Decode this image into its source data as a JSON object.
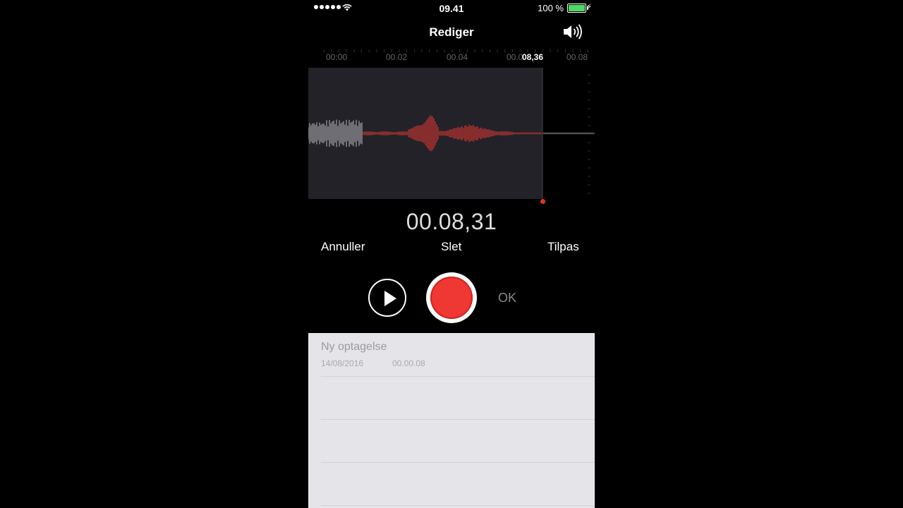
{
  "status_bar": {
    "time": "09.41",
    "battery_percent": "100 %",
    "signal_dots": 5,
    "battery_color": "#4cd964"
  },
  "nav": {
    "title": "Rediger",
    "speaker_icon": "speaker-icon"
  },
  "timeline": {
    "ticks": [
      "00:00",
      "00.02",
      "00.04",
      "00.0",
      "00.08"
    ],
    "playhead_time": "08,36"
  },
  "recording": {
    "elapsed": "00.08,31",
    "accent_color": "#ef3833"
  },
  "actions": {
    "cancel": "Annuller",
    "delete": "Slet",
    "trim": "Tilpas"
  },
  "controls": {
    "play_icon": "play-icon",
    "record_icon": "record-icon",
    "done": "OK"
  },
  "recordings": [
    {
      "title": "Ny optagelse",
      "date": "14/08/2016",
      "duration": "00.00.08"
    }
  ]
}
